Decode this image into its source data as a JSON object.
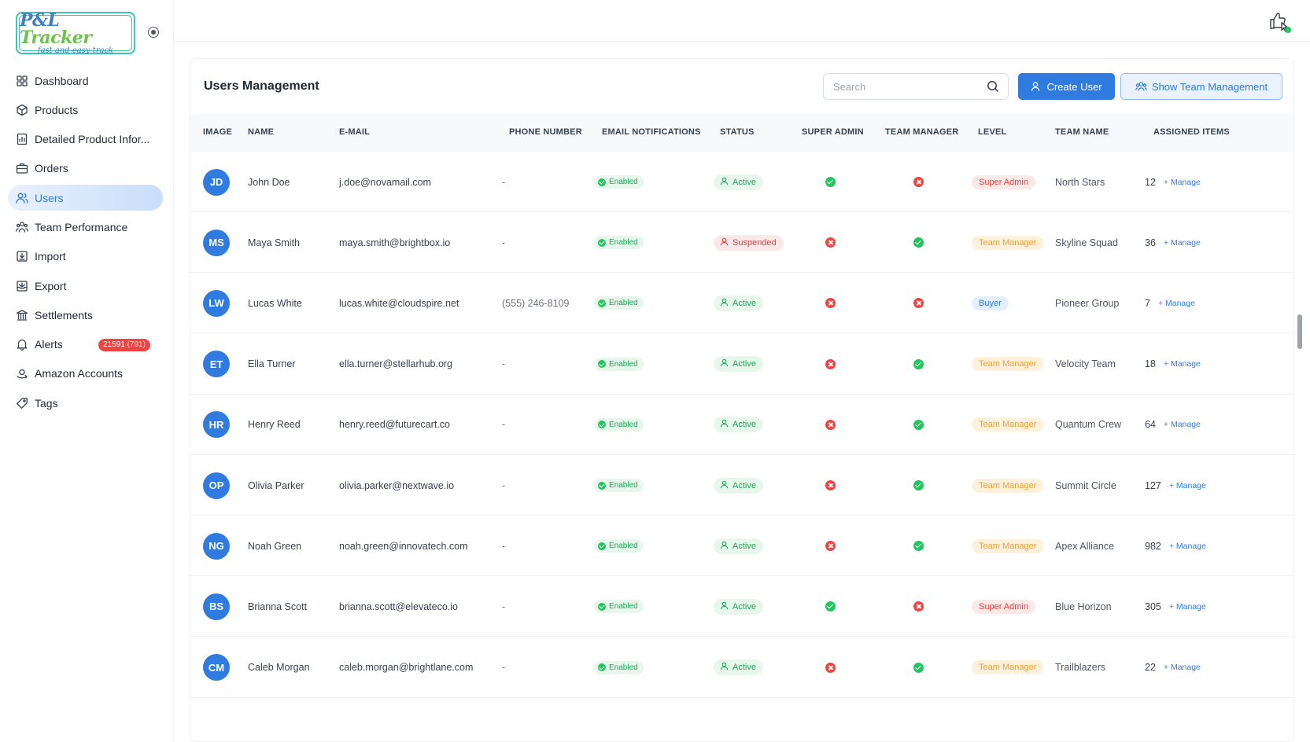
{
  "logo": {
    "title_a": "P&L ",
    "title_b": "Tracker",
    "tagline": "fast and easy track"
  },
  "sidebar": {
    "items": [
      {
        "label": "Dashboard",
        "icon": "dashboard-icon"
      },
      {
        "label": "Products",
        "icon": "box-icon"
      },
      {
        "label": "Detailed Product Infor...",
        "icon": "report-icon"
      },
      {
        "label": "Orders",
        "icon": "briefcase-icon"
      },
      {
        "label": "Users",
        "icon": "users-icon",
        "active": true
      },
      {
        "label": "Team Performance",
        "icon": "team-icon"
      },
      {
        "label": "Import",
        "icon": "import-icon"
      },
      {
        "label": "Export",
        "icon": "export-icon"
      },
      {
        "label": "Settlements",
        "icon": "bank-icon"
      },
      {
        "label": "Alerts",
        "icon": "bell-icon",
        "badge": "21591",
        "badge_sub": "(791)"
      },
      {
        "label": "Amazon Accounts",
        "icon": "amazon-icon"
      },
      {
        "label": "Tags",
        "icon": "tag-icon"
      }
    ]
  },
  "header": {
    "icon": "like-cursor-icon",
    "status_color": "#22c55e"
  },
  "main": {
    "title": "Users Management",
    "search_placeholder": "Search",
    "create_label": "Create User",
    "team_label": "Show Team Management",
    "columns": [
      "IMAGE",
      "NAME",
      "E-MAIL",
      "PHONE NUMBER",
      "EMAIL NOTIFICATIONS",
      "STATUS",
      "SUPER ADMIN",
      "TEAM MANAGER",
      "LEVEL",
      "TEAM NAME",
      "ASSIGNED ITEMS"
    ],
    "manage_label": "+ Manage",
    "rows": [
      {
        "initials": "JD",
        "name": "John Doe",
        "email": "j.doe@novamail.com",
        "phone": "-",
        "notif": "Enabled",
        "status": "Active",
        "super_admin": true,
        "team_manager": false,
        "level": "Super Admin",
        "team": "North Stars",
        "items": "12"
      },
      {
        "initials": "MS",
        "name": "Maya Smith",
        "email": "maya.smith@brightbox.io",
        "phone": "-",
        "notif": "Enabled",
        "status": "Suspended",
        "super_admin": false,
        "team_manager": true,
        "level": "Team Manager",
        "team": "Skyline Squad",
        "items": "36"
      },
      {
        "initials": "LW",
        "name": "Lucas White",
        "email": "lucas.white@cloudspire.net",
        "phone": "(555) 246-8109",
        "notif": "Enabled",
        "status": "Active",
        "super_admin": false,
        "team_manager": false,
        "level": "Buyer",
        "team": "Pioneer Group",
        "items": "7"
      },
      {
        "initials": "ET",
        "name": "Ella Turner",
        "email": "ella.turner@stellarhub.org",
        "phone": "-",
        "notif": "Enabled",
        "status": "Active",
        "super_admin": false,
        "team_manager": true,
        "level": "Team Manager",
        "team": "Velocity Team",
        "items": "18"
      },
      {
        "initials": "HR",
        "name": "Henry Reed",
        "email": "henry.reed@futurecart.co",
        "phone": "-",
        "notif": "Enabled",
        "status": "Active",
        "super_admin": false,
        "team_manager": true,
        "level": "Team Manager",
        "team": "Quantum Crew",
        "items": "64"
      },
      {
        "initials": "OP",
        "name": "Olivia Parker",
        "email": "olivia.parker@nextwave.io",
        "phone": "-",
        "notif": "Enabled",
        "status": "Active",
        "super_admin": false,
        "team_manager": true,
        "level": "Team Manager",
        "team": "Summit Circle",
        "items": "127"
      },
      {
        "initials": "NG",
        "name": "Noah Green",
        "email": "noah.green@innovatech.com",
        "phone": "-",
        "notif": "Enabled",
        "status": "Active",
        "super_admin": false,
        "team_manager": true,
        "level": "Team Manager",
        "team": "Apex Alliance",
        "items": "982"
      },
      {
        "initials": "BS",
        "name": "Brianna Scott",
        "email": "brianna.scott@elevateco.io",
        "phone": "-",
        "notif": "Enabled",
        "status": "Active",
        "super_admin": true,
        "team_manager": false,
        "level": "Super Admin",
        "team": "Blue Horizon",
        "items": "305"
      },
      {
        "initials": "CM",
        "name": "Caleb Morgan",
        "email": "caleb.morgan@brightlane.com",
        "phone": "-",
        "notif": "Enabled",
        "status": "Active",
        "super_admin": false,
        "team_manager": true,
        "level": "Team Manager",
        "team": "Trailblazers",
        "items": "22"
      }
    ]
  }
}
